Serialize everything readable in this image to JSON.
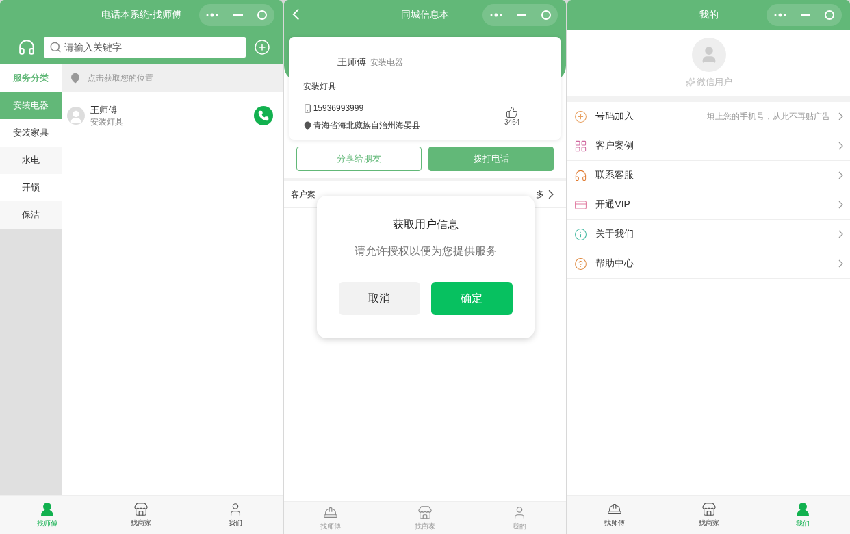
{
  "master": {
    "title": "电话本系统-找师傅",
    "search": {
      "placeholder": "请输入关键字"
    },
    "category_header": "服务分类",
    "categories": [
      {
        "label": "安装电器",
        "selected": true
      },
      {
        "label": "安装家具",
        "selected": false
      },
      {
        "label": "水电",
        "selected": false
      },
      {
        "label": "开锁",
        "selected": false
      },
      {
        "label": "保洁",
        "selected": false
      }
    ],
    "location": "点击获取您的位置",
    "workers": [
      {
        "name": "王师傅",
        "service": "安装灯具"
      }
    ],
    "tab_bar": [
      {
        "label": "找师傅",
        "selected": true
      },
      {
        "label": "找商家",
        "selected": false
      },
      {
        "label": "我们",
        "selected": false
      }
    ]
  },
  "detail": {
    "title": "同城信息本",
    "card": {
      "name": "王师傅",
      "category": "安装电器",
      "service": "安装灯具",
      "phone": "15936993999",
      "address": "青海省海北藏族自治州海晏县",
      "likes": "3464"
    },
    "buttons": [
      "分享给朋友",
      "拨打电话"
    ],
    "section": {
      "label": "客户案",
      "more": "多"
    },
    "dialog": {
      "title": "获取用户信息",
      "message": "请允许授权以便为您提供服务",
      "cancel": "取消",
      "confirm": "确定"
    },
    "tab_bar": [
      {
        "label": "找师傅",
        "selected": false
      },
      {
        "label": "找商家",
        "selected": false
      },
      {
        "label": "我的",
        "selected": false
      }
    ]
  },
  "profile": {
    "title": "我的",
    "user_name": "微信用户",
    "menu": [
      {
        "label": "号码加入",
        "hint": "填上您的手机号，从此不再贴广告"
      },
      {
        "label": "客户案例"
      },
      {
        "label": "联系客服"
      },
      {
        "label": "开通VIP"
      },
      {
        "label": "关于我们"
      },
      {
        "label": "帮助中心"
      }
    ],
    "tab_bar": [
      {
        "label": "找师傅",
        "selected": false
      },
      {
        "label": "找商家",
        "selected": false
      },
      {
        "label": "我们",
        "selected": true
      }
    ]
  }
}
